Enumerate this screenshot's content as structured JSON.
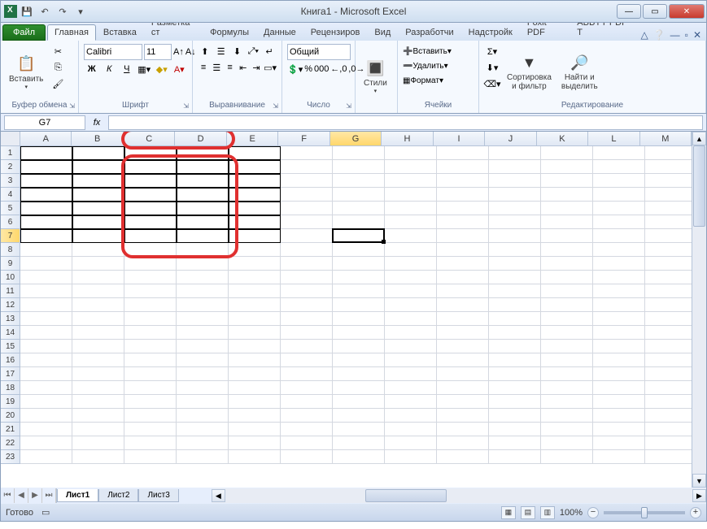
{
  "title": "Книга1  -  Microsoft Excel",
  "qat": {
    "save": "💾",
    "undo": "↶",
    "redo": "↷"
  },
  "file_tab": "Файл",
  "tabs": [
    "Главная",
    "Вставка",
    "Разметка ст",
    "Формулы",
    "Данные",
    "Рецензиров",
    "Вид",
    "Разработчи",
    "Надстройк",
    "Foxit PDF",
    "ABBYY PDF T"
  ],
  "active_tab": 0,
  "ribbon": {
    "clipboard": {
      "label": "Буфер обмена",
      "paste": "Вставить"
    },
    "font": {
      "label": "Шрифт",
      "name": "Calibri",
      "size": "11",
      "bold": "Ж",
      "italic": "К",
      "underline": "Ч"
    },
    "align": {
      "label": "Выравнивание"
    },
    "number": {
      "label": "Число",
      "format": "Общий"
    },
    "styles": {
      "label": "Стили",
      "btn": "Стили"
    },
    "cells": {
      "label": "Ячейки",
      "insert": "Вставить",
      "delete": "Удалить",
      "format": "Формат"
    },
    "editing": {
      "label": "Редактирование",
      "sort": "Сортировка\nи фильтр",
      "find": "Найти и\nвыделить"
    }
  },
  "name_box": "G7",
  "fx": "fx",
  "columns": [
    "A",
    "B",
    "C",
    "D",
    "E",
    "F",
    "G",
    "H",
    "I",
    "J",
    "K",
    "L",
    "M"
  ],
  "rows": [
    "1",
    "2",
    "3",
    "4",
    "5",
    "6",
    "7",
    "8",
    "9",
    "10",
    "11",
    "12",
    "13",
    "14",
    "15",
    "16",
    "17",
    "18",
    "19",
    "20",
    "21",
    "22",
    "23"
  ],
  "selected_col": "G",
  "selected_row": "7",
  "bordered_range": {
    "cols": [
      "A",
      "B",
      "C",
      "D",
      "E"
    ],
    "rows": [
      "1",
      "2",
      "3",
      "4",
      "5",
      "6",
      "7"
    ]
  },
  "sheet_nav": [
    "⏮",
    "◀",
    "▶",
    "⏭"
  ],
  "sheets": [
    "Лист1",
    "Лист2",
    "Лист3"
  ],
  "active_sheet": 0,
  "status": "Готово",
  "zoom": "100%"
}
